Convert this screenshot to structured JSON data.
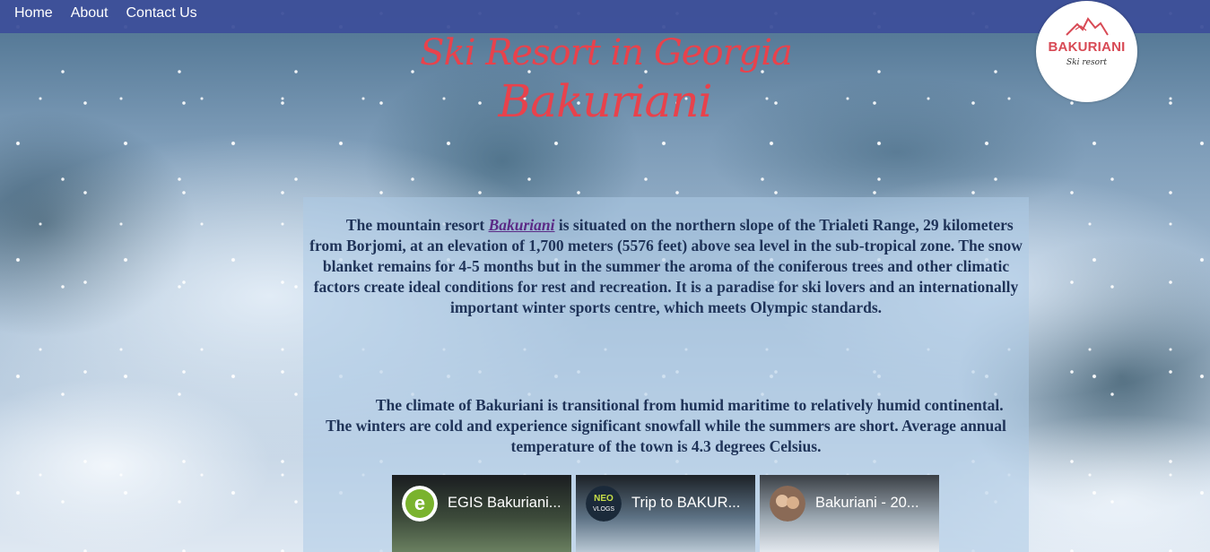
{
  "nav": {
    "items": [
      "Home",
      "About",
      "Contact Us"
    ]
  },
  "logo": {
    "name": "BAKURIANI",
    "subtitle": "Ski resort"
  },
  "header": {
    "line1": "Ski Resort in Georgia",
    "line2": "Bakuriani"
  },
  "article": {
    "p1_prefix": "The mountain resort ",
    "p1_link": "Bakuriani",
    "p1_rest": " is situated on the northern slope of the Trialeti Range, 29 kilometers from Borjomi, at an elevation of 1,700 meters (5576 feet) above sea level in the sub-tropical zone. The snow blanket remains for 4-5 months but in the summer the aroma of the coniferous trees and other climatic factors create ideal conditions for rest and recreation. It is a paradise for ski lovers and an internationally important winter sports centre, which meets Olympic standards.",
    "p2": "The climate of Bakuriani is transitional from humid maritime to relatively humid continental. The winters are cold and experience significant snowfall while the summers are short. Average annual temperature of the town is 4.3 degrees Celsius."
  },
  "videos": [
    {
      "title": "EGIS Bakuriani...",
      "icon": "channel-avatar-e",
      "color": "#7ab32e"
    },
    {
      "title": "Trip to BAKUR...",
      "icon": "channel-avatar-neo-vlogs",
      "color": "#f2f2f2"
    },
    {
      "title": "Bakuriani - 20...",
      "icon": "channel-avatar-people",
      "color": "#d9b08c"
    }
  ],
  "colors": {
    "nav_bar": "#3d4f9a",
    "heading": "#e8424c",
    "body_text": "#1f3358",
    "link": "#5b2a86"
  }
}
